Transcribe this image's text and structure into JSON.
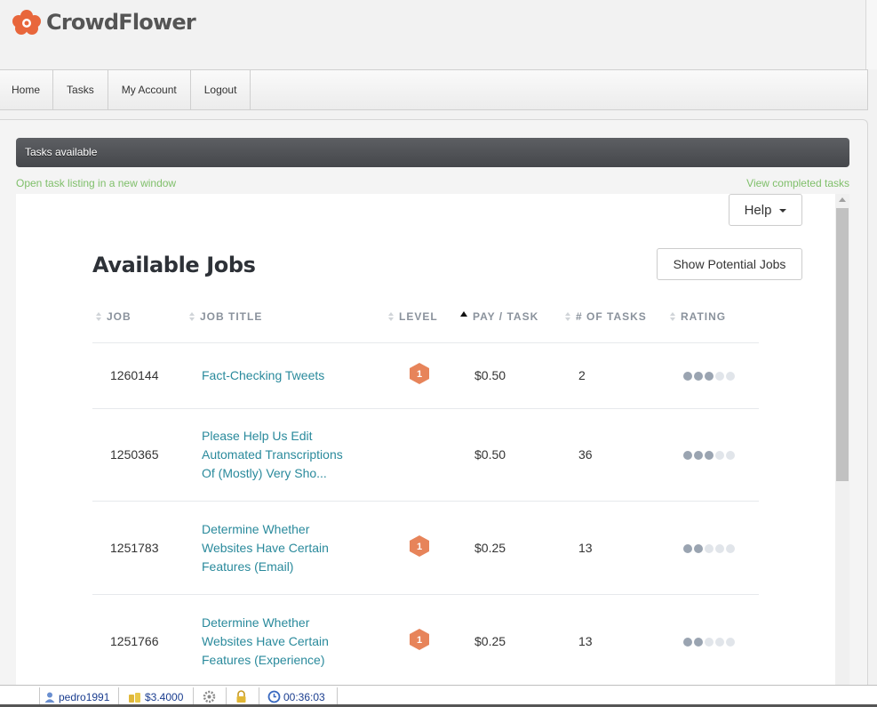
{
  "brand": {
    "name": "CrowdFlower",
    "color": "#e8663b"
  },
  "nav": {
    "items": [
      "Home",
      "Tasks",
      "My Account",
      "Logout"
    ]
  },
  "panel": {
    "header": "Tasks available",
    "open_link": "Open task listing in a new window",
    "completed_link": "View completed tasks"
  },
  "jobs": {
    "help_label": "Help",
    "title": "Available Jobs",
    "potential_label": "Show Potential Jobs",
    "columns": [
      "JOB",
      "JOB TITLE",
      "LEVEL",
      "PAY / TASK",
      "# OF TASKS",
      "RATING"
    ],
    "sorted_by": "PAY / TASK",
    "rows": [
      {
        "id": "1260144",
        "title": [
          "Fact-Checking Tweets"
        ],
        "level": "1",
        "pay": "$0.50",
        "tasks": "2",
        "rating": 3
      },
      {
        "id": "1250365",
        "title": [
          "Please Help Us Edit",
          "Automated Transcriptions",
          "Of (Mostly) Very Sho..."
        ],
        "level": "",
        "pay": "$0.50",
        "tasks": "36",
        "rating": 3
      },
      {
        "id": "1251783",
        "title": [
          "Determine Whether",
          "Websites Have Certain",
          "Features (Email)"
        ],
        "level": "1",
        "pay": "$0.25",
        "tasks": "13",
        "rating": 2
      },
      {
        "id": "1251766",
        "title": [
          "Determine Whether",
          "Websites Have Certain",
          "Features (Experience)"
        ],
        "level": "1",
        "pay": "$0.25",
        "tasks": "13",
        "rating": 2
      }
    ],
    "rating_max": 5
  },
  "taskbar": {
    "user": "pedro1991",
    "balance": "$3.4000",
    "timer": "00:36:03",
    "icons": [
      "user-icon",
      "coins-icon",
      "gear-icon",
      "lock-icon",
      "clock-icon"
    ]
  }
}
